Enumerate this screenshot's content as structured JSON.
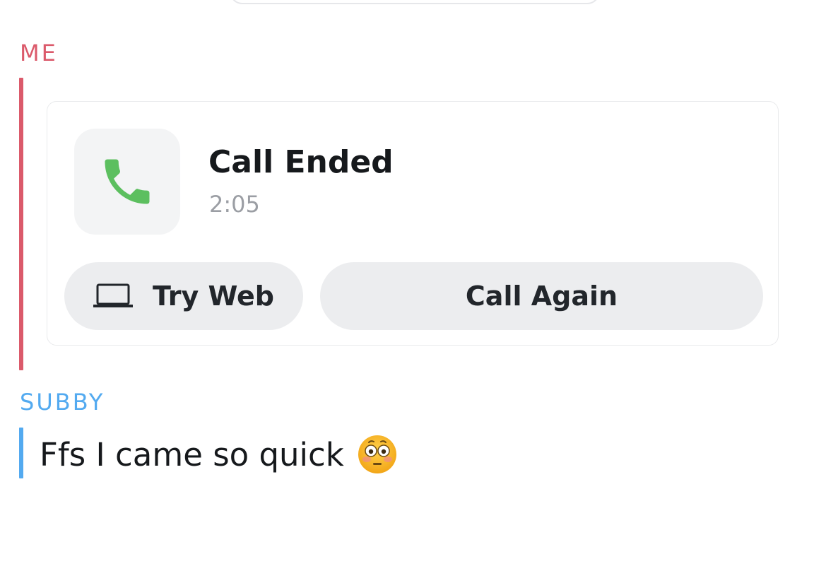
{
  "chat": {
    "me_label": "ME",
    "other_label": "SUBBY",
    "call_card": {
      "title": "Call Ended",
      "duration": "2:05",
      "icon": "phone-icon",
      "try_web_label": "Try Web",
      "try_web_icon": "laptop-icon",
      "call_again_label": "Call Again"
    },
    "message": {
      "text": "Ffs I came so quick",
      "emoji": "flushed-face-emoji"
    }
  },
  "colors": {
    "me": "#db5a6b",
    "other": "#53aaf0",
    "call_green": "#5cbf5f",
    "button_bg": "#ecedef"
  }
}
